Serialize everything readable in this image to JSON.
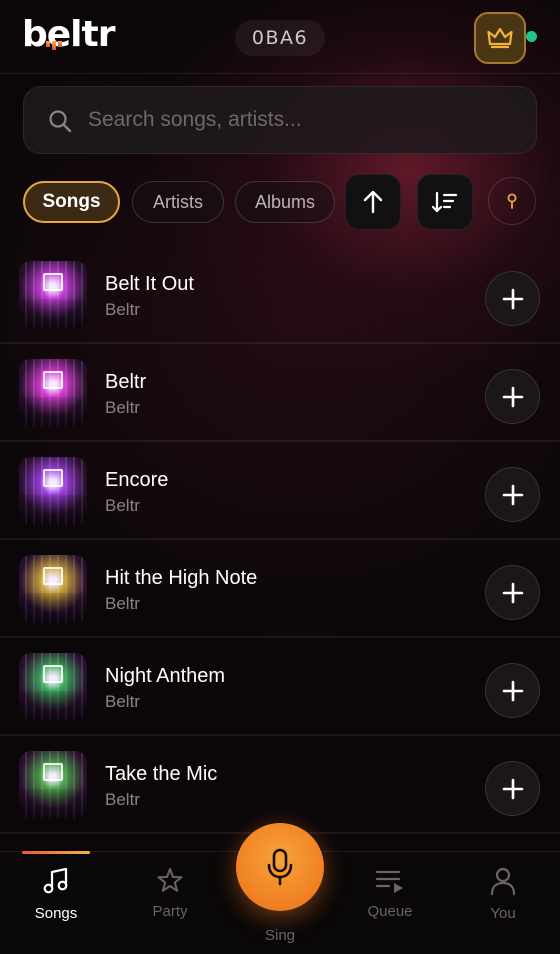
{
  "header": {
    "logo_text": "beltr",
    "room_code": "0BA6",
    "crown_icon": "crown-icon",
    "status_color": "#22c58a"
  },
  "search": {
    "placeholder": "Search songs, artists..."
  },
  "filters": {
    "chips": [
      "Songs",
      "Artists",
      "Albums"
    ],
    "active": "Songs",
    "sort_direction_icon": "arrow-up-icon",
    "sort_icon": "sort-list-icon",
    "pin_icon": "pin-icon"
  },
  "songs": [
    {
      "title": "Belt It Out",
      "artist": "Beltr",
      "accent": "#c23bd6"
    },
    {
      "title": "Beltr",
      "artist": "Beltr",
      "accent": "#d33ad0"
    },
    {
      "title": "Encore",
      "artist": "Beltr",
      "accent": "#9a3fe0"
    },
    {
      "title": "Hit the High Note",
      "artist": "Beltr",
      "accent": "#c9a23a"
    },
    {
      "title": "Night Anthem",
      "artist": "Beltr",
      "accent": "#3aa85a"
    },
    {
      "title": "Take the Mic",
      "artist": "Beltr",
      "accent": "#4aa24a"
    }
  ],
  "nav": {
    "items": [
      {
        "label": "Songs",
        "icon": "music-note-icon",
        "active": true
      },
      {
        "label": "Party",
        "icon": "star-icon",
        "active": false
      },
      {
        "label": "Queue",
        "icon": "queue-icon",
        "active": false
      },
      {
        "label": "You",
        "icon": "user-icon",
        "active": false
      }
    ],
    "center_label": "Sing",
    "center_icon": "microphone-icon",
    "accent_color": "#f08a2a"
  }
}
